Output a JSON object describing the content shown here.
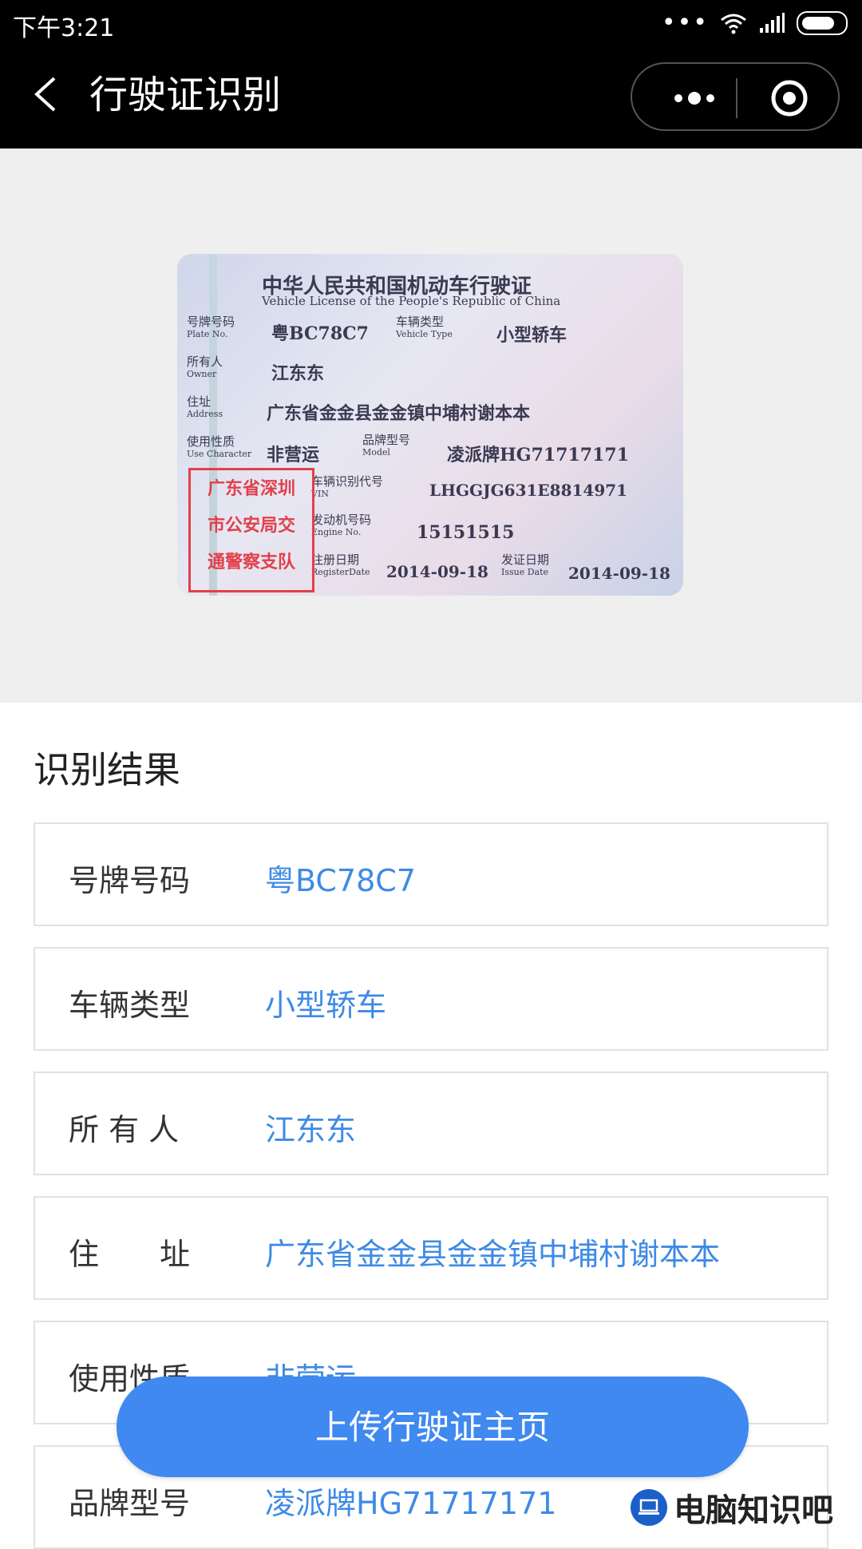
{
  "status_bar": {
    "time": "下午3:21"
  },
  "nav": {
    "title": "行驶证识别"
  },
  "license_image": {
    "title_cn": "中华人民共和国机动车行驶证",
    "title_en": "Vehicle License of the People's Republic of China",
    "plate": "粤BC78C7",
    "vehicle_type": "小型轿车",
    "owner": "江东东",
    "address": "广东省金金县金金镇中埔村谢本本",
    "use_character": "非营运",
    "model": "凌派牌HG71717171",
    "vin": "LHGGJG631E8814971",
    "engine_no": "15151515",
    "register_date": "2014-09-18",
    "issue_date": "2014-09-18",
    "stamp_lines": [
      "广东省深圳",
      "市公安局交",
      "通警察支队"
    ],
    "labels": {
      "plate": "号牌号码",
      "plate_en": "Plate No.",
      "type": "车辆类型",
      "type_en": "Vehicle Type",
      "owner": "所有人",
      "owner_en": "Owner",
      "address": "住址",
      "address_en": "Address",
      "use": "使用性质",
      "use_en": "Use Character",
      "model": "品牌型号",
      "model_en": "Model",
      "vin": "车辆识别代号",
      "vin_en": "VIN",
      "engine": "发动机号码",
      "engine_en": "Engine No.",
      "register": "注册日期",
      "register_en": "RegisterDate",
      "issue": "发证日期",
      "issue_en": "Issue Date"
    }
  },
  "results": {
    "heading": "识别结果",
    "rows": [
      {
        "label": "号牌号码",
        "value": "粤BC78C7"
      },
      {
        "label": "车辆类型",
        "value": "小型轿车"
      },
      {
        "label": "所 有 人",
        "value": "江东东"
      },
      {
        "label": "住　　址",
        "value": "广东省金金县金金镇中埔村谢本本"
      },
      {
        "label": "使用性质",
        "value": "非营运"
      },
      {
        "label": "品牌型号",
        "value": "凌派牌HG71717171"
      }
    ]
  },
  "upload_button": {
    "label": "上传行驶证主页"
  },
  "watermark": {
    "text": "电脑知识吧"
  }
}
